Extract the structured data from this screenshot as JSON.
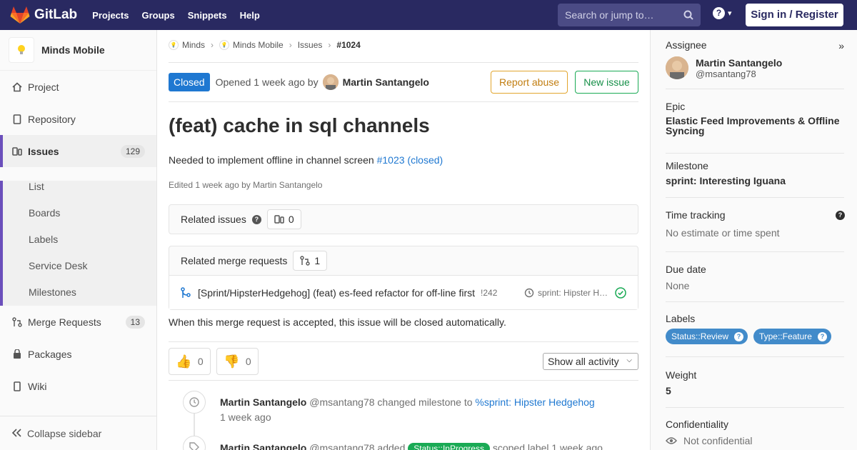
{
  "navbar": {
    "brand": "GitLab",
    "links": [
      "Projects",
      "Groups",
      "Snippets",
      "Help"
    ],
    "search_placeholder": "Search or jump to…",
    "signin_label": "Sign in / Register",
    "help_glyph": "?"
  },
  "sidebar": {
    "project_name": "Minds Mobile",
    "items": [
      {
        "label": "Project",
        "icon": "home-icon"
      },
      {
        "label": "Repository",
        "icon": "doc-icon"
      },
      {
        "label": "Issues",
        "icon": "issues-icon",
        "count": "129",
        "active": true
      },
      {
        "label": "Merge Requests",
        "icon": "merge-request-icon",
        "count": "13"
      },
      {
        "label": "Packages",
        "icon": "package-icon"
      },
      {
        "label": "Wiki",
        "icon": "book-icon"
      }
    ],
    "sub_items": [
      "List",
      "Boards",
      "Labels",
      "Service Desk",
      "Milestones"
    ],
    "collapse_label": "Collapse sidebar"
  },
  "breadcrumb": {
    "items": [
      "Minds",
      "Minds Mobile",
      "Issues"
    ],
    "current": "#1024"
  },
  "issue": {
    "status": "Closed",
    "opened_text": "Opened 1 week ago by",
    "author": "Martin Santangelo",
    "report_abuse_label": "Report abuse",
    "new_issue_label": "New issue",
    "title": "(feat) cache in sql channels",
    "description_text": "Needed to implement offline in channel screen ",
    "description_link": "#1023 (closed)",
    "edited_text": "Edited 1 week ago by Martin Santangelo"
  },
  "related_issues": {
    "title": "Related issues",
    "count": "0"
  },
  "related_mrs": {
    "title": "Related merge requests",
    "count": "1",
    "items": [
      {
        "title": "[Sprint/HipsterHedgehog] (feat) es-feed refactor for off-line first",
        "ref": "!242",
        "milestone": "sprint: Hipster H…"
      }
    ]
  },
  "autoclose_text": "When this merge request is accepted, this issue will be closed automatically.",
  "reactions": {
    "thumbs_up": "0",
    "thumbs_down": "0"
  },
  "activity_filter": "Show all activity",
  "timeline": [
    {
      "author": "Martin Santangelo",
      "handle": "@msantang78",
      "action": "changed milestone to",
      "target": "%sprint: Hipster Hedgehog",
      "time": "1 week ago"
    },
    {
      "author": "Martin Santangelo",
      "handle": "@msantang78",
      "action": "added",
      "label": "Status::InProgress",
      "suffix": "scoped label 1 week ago"
    }
  ],
  "rsidebar": {
    "assignee_label": "Assignee",
    "assignee_name": "Martin Santangelo",
    "assignee_handle": "@msantang78",
    "epic_label": "Epic",
    "epic_value": "Elastic Feed Improvements & Offline Syncing",
    "milestone_label": "Milestone",
    "milestone_value": "sprint: Interesting Iguana",
    "time_label": "Time tracking",
    "time_value": "No estimate or time spent",
    "due_label": "Due date",
    "due_value": "None",
    "labels_label": "Labels",
    "labels": [
      "Status::Review",
      "Type::Feature"
    ],
    "weight_label": "Weight",
    "weight_value": "5",
    "confidentiality_label": "Confidentiality",
    "confidentiality_value": "Not confidential"
  },
  "colors": {
    "navbar": "#292961",
    "accent": "#6b4fbb",
    "link": "#1f78d1",
    "closed_badge": "#1f78d1",
    "success": "#1aaa55",
    "warning": "#e2a52e",
    "label_blue": "#428bca"
  }
}
